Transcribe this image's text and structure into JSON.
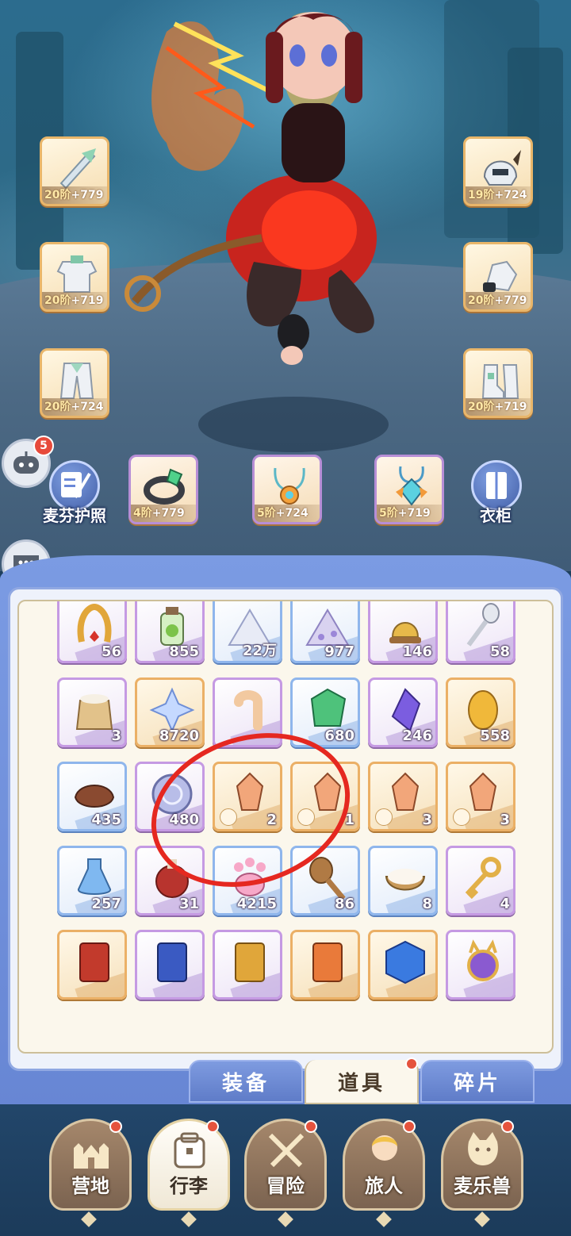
{
  "equipment": {
    "left": [
      {
        "name": "weapon",
        "level": "20阶",
        "bonus": "+779"
      },
      {
        "name": "armor",
        "level": "20阶",
        "bonus": "+719"
      },
      {
        "name": "pants",
        "level": "20阶",
        "bonus": "+724"
      }
    ],
    "right": [
      {
        "name": "helmet",
        "level": "19阶",
        "bonus": "+724"
      },
      {
        "name": "gloves",
        "level": "20阶",
        "bonus": "+779"
      },
      {
        "name": "boots",
        "level": "20阶",
        "bonus": "+719"
      }
    ],
    "accessories": [
      {
        "name": "ring",
        "level": "4阶",
        "bonus": "+779"
      },
      {
        "name": "necklace",
        "level": "5阶",
        "bonus": "+724"
      },
      {
        "name": "amulet",
        "level": "5阶",
        "bonus": "+719"
      }
    ]
  },
  "buttons": {
    "passport_label": "麦芬护照",
    "wardrobe_label": "衣柜",
    "friend_badge": "5"
  },
  "inventory": {
    "items": [
      {
        "name": "horseshoe-charm",
        "count": "56",
        "rarity": "purple"
      },
      {
        "name": "potion-bottle",
        "count": "855",
        "rarity": "purple"
      },
      {
        "name": "white-powder-pile",
        "count": "22万",
        "rarity": "blue"
      },
      {
        "name": "purple-powder-pile",
        "count": "977",
        "rarity": "blue"
      },
      {
        "name": "golden-bell",
        "count": "146",
        "rarity": "purple"
      },
      {
        "name": "magic-spoon",
        "count": "58",
        "rarity": "purple"
      },
      {
        "name": "flour-sack",
        "count": "3",
        "rarity": "purple"
      },
      {
        "name": "star-crystal",
        "count": "8720",
        "rarity": "gold"
      },
      {
        "name": "worm",
        "count": "",
        "rarity": "purple"
      },
      {
        "name": "green-gem",
        "count": "680",
        "rarity": "blue"
      },
      {
        "name": "purple-crystal",
        "count": "246",
        "rarity": "purple"
      },
      {
        "name": "golden-egg",
        "count": "558",
        "rarity": "gold"
      },
      {
        "name": "fur-pelt",
        "count": "435",
        "rarity": "blue"
      },
      {
        "name": "silver-coin",
        "count": "480",
        "rarity": "purple"
      },
      {
        "name": "helmet-crystal",
        "count": "2",
        "rarity": "gold"
      },
      {
        "name": "pants-crystal",
        "count": "1",
        "rarity": "gold"
      },
      {
        "name": "armor-crystal",
        "count": "3",
        "rarity": "gold"
      },
      {
        "name": "boots-crystal",
        "count": "3",
        "rarity": "gold"
      },
      {
        "name": "blue-potion",
        "count": "257",
        "rarity": "blue"
      },
      {
        "name": "red-potion",
        "count": "31",
        "rarity": "purple"
      },
      {
        "name": "paw-candy",
        "count": "4215",
        "rarity": "blue"
      },
      {
        "name": "wooden-spoon",
        "count": "86",
        "rarity": "blue"
      },
      {
        "name": "rice-bowl",
        "count": "8",
        "rarity": "blue"
      },
      {
        "name": "golden-key",
        "count": "4",
        "rarity": "purple"
      },
      {
        "name": "red-card",
        "count": "",
        "rarity": "gold"
      },
      {
        "name": "blue-card",
        "count": "",
        "rarity": "purple"
      },
      {
        "name": "gold-card",
        "count": "",
        "rarity": "purple"
      },
      {
        "name": "orange-card",
        "count": "",
        "rarity": "gold"
      },
      {
        "name": "blue-cube",
        "count": "",
        "rarity": "gold"
      },
      {
        "name": "cat-mirror",
        "count": "",
        "rarity": "purple"
      }
    ]
  },
  "tabs": [
    {
      "label": "装备",
      "active": false
    },
    {
      "label": "道具",
      "active": true
    },
    {
      "label": "碎片",
      "active": false
    }
  ],
  "nav": [
    {
      "label": "营地",
      "icon": "castle-icon"
    },
    {
      "label": "行李",
      "icon": "backpack-icon"
    },
    {
      "label": "冒险",
      "icon": "crossed-swords-icon"
    },
    {
      "label": "旅人",
      "icon": "traveler-icon"
    },
    {
      "label": "麦乐兽",
      "icon": "cat-icon"
    }
  ],
  "colors": {
    "accent_blue": "#6786d4",
    "rarity_gold": "#ebb066",
    "rarity_purple": "#c59ae3",
    "rarity_blue": "#8fb6ec",
    "notification_red": "#e5533d",
    "annotation_red": "#e52820"
  }
}
